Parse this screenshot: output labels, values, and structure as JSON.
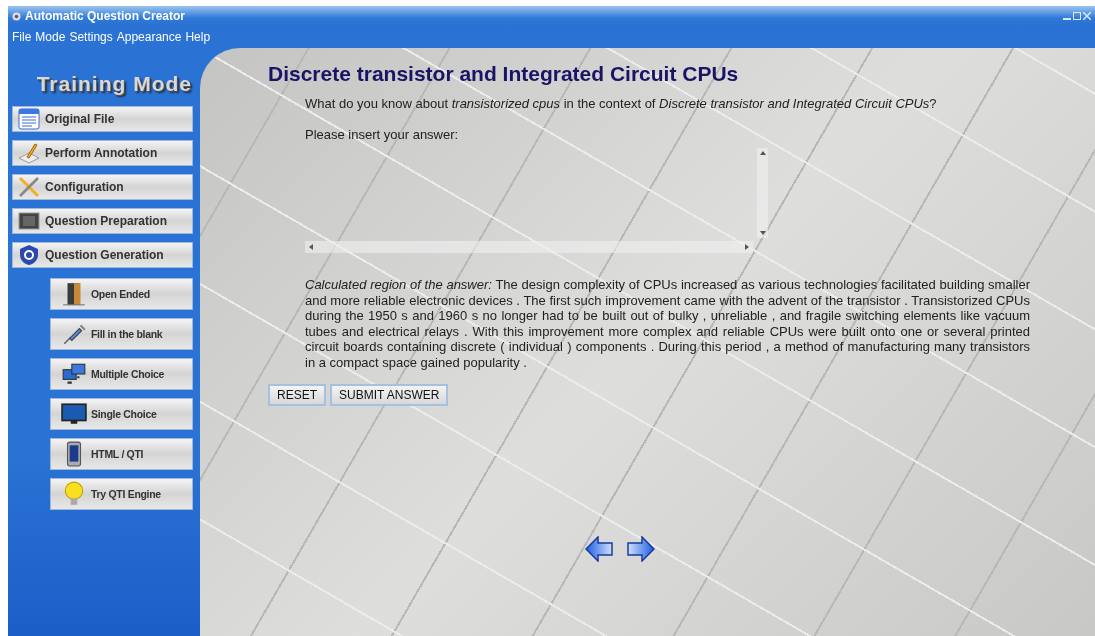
{
  "window": {
    "title": "Automatic Question Creator"
  },
  "menu": {
    "items": [
      "File",
      "Mode",
      "Settings",
      "Appearance",
      "Help"
    ]
  },
  "sidebar": {
    "heading": "Training Mode",
    "items": [
      {
        "label": "Original File",
        "kind": "main"
      },
      {
        "label": "Perform Annotation",
        "kind": "main"
      },
      {
        "label": "Configuration",
        "kind": "main"
      },
      {
        "label": "Question Preparation",
        "kind": "main"
      },
      {
        "label": "Question Generation",
        "kind": "main"
      },
      {
        "label": "Open Ended",
        "kind": "sub"
      },
      {
        "label": "Fill in the blank",
        "kind": "sub"
      },
      {
        "label": "Multiple Choice",
        "kind": "sub"
      },
      {
        "label": "Single Choice",
        "kind": "sub"
      },
      {
        "label": "HTML / QTI",
        "kind": "sub"
      },
      {
        "label": "Try QTI Engine",
        "kind": "sub"
      }
    ]
  },
  "content": {
    "title": "Discrete transistor and Integrated Circuit CPUs",
    "question": "What do you know about *transistorized cpus* in the context of *Discrete transistor and Integrated Circuit CPUs*?",
    "prompt": "Please insert your answer:",
    "calculated_region": "*Calculated region of the answer:* The design complexity of CPUs increased as various technologies facilitated building smaller and more reliable electronic devices . The first such improvement came with the advent of the transistor . Transistorized CPUs during the 1950 s and 1960 s no longer had to be built out of bulky , unreliable , and fragile switching elements like vacuum tubes and electrical relays . With this improvement more complex and reliable CPUs were built onto one or several printed circuit boards containing discrete ( individual ) components . During this period , a method of manufacturing many transistors in a compact space gained popularity .",
    "buttons": [
      "RESET",
      "SUBMIT ANSWER"
    ]
  }
}
